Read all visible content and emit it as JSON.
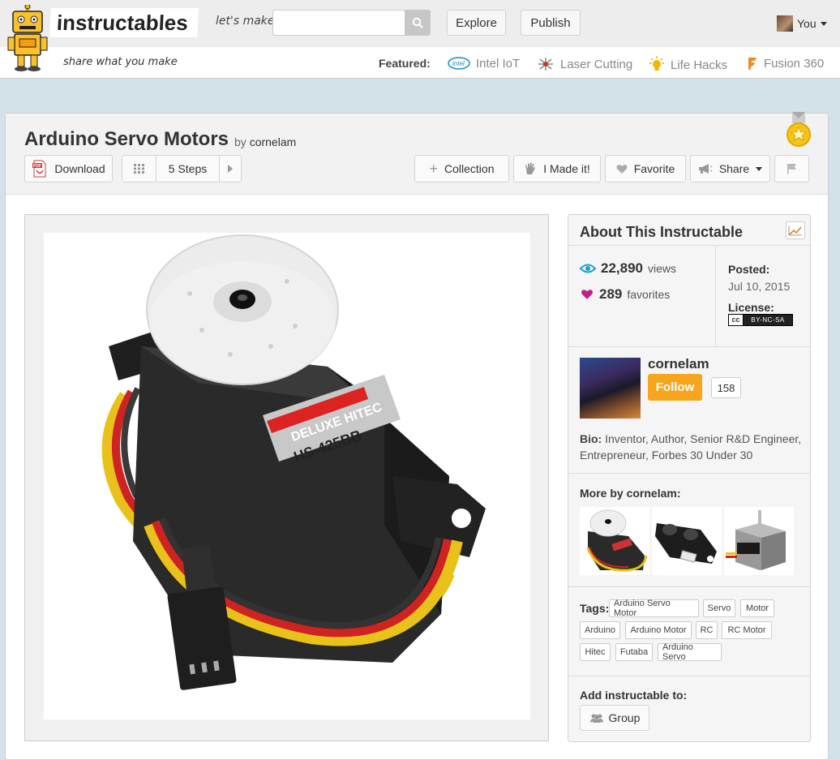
{
  "header": {
    "logo_text": "instructables",
    "tagline": "share what you make",
    "lets_make": "let's make",
    "search_placeholder": "",
    "explore_label": "Explore",
    "publish_label": "Publish",
    "user_label": "You",
    "featured_label": "Featured:",
    "featured": [
      {
        "label": "Intel IoT",
        "icon": "intel-icon"
      },
      {
        "label": "Laser Cutting",
        "icon": "laser-icon"
      },
      {
        "label": "Life Hacks",
        "icon": "lightbulb-icon"
      },
      {
        "label": "Fusion 360",
        "icon": "fusion-icon"
      }
    ]
  },
  "article": {
    "title": "Arduino Servo Motors",
    "by": "by",
    "author": "cornelam",
    "download_label": "Download",
    "steps_label": "5 Steps",
    "collection_label": "Collection",
    "made_it_label": "I Made it!",
    "favorite_label": "Favorite",
    "share_label": "Share"
  },
  "about": {
    "title": "About This Instructable",
    "views_num": "22,890",
    "views_label": "views",
    "favorites_num": "289",
    "favorites_label": "favorites",
    "posted_label": "Posted:",
    "posted_date": "Jul 10, 2015",
    "license_label": "License:",
    "license_badge": "BY-NC-SA",
    "license_cc": "cc",
    "author_name": "cornelam",
    "follow_label": "Follow",
    "follower_count": "158",
    "bio_label": "Bio:",
    "bio_text": "Inventor, Author, Senior R&D Engineer, Entrepreneur, Forbes 30 Under 30",
    "more_by_label": "More by cornelam:",
    "tags_label": "Tags:",
    "tags": [
      "Arduino Servo Motor",
      "Servo",
      "Motor",
      "Arduino",
      "Arduino Motor",
      "RC",
      "RC Motor",
      "Hitec",
      "Futaba",
      "Arduino Servo"
    ],
    "add_label": "Add instructable to:",
    "group_label": "Group"
  },
  "colors": {
    "accent_orange": "#f7a51c",
    "views_icon": "#1a9fd9",
    "favorites_icon": "#c0208a",
    "page_bg": "#d3e1e8"
  }
}
